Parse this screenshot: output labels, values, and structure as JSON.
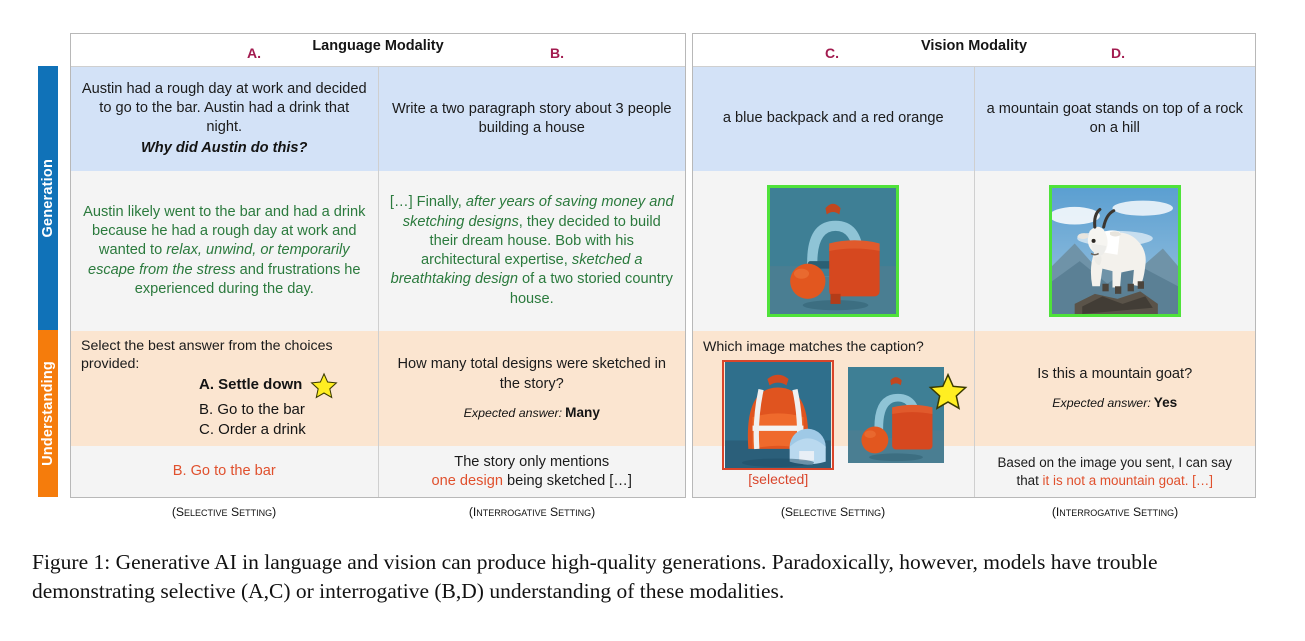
{
  "figure": {
    "sidebar": {
      "bands": [
        {
          "label": "Generation",
          "color": "#1072b8"
        },
        {
          "label": "Understanding",
          "color": "#f57c0c"
        }
      ]
    },
    "panels": [
      {
        "title": "Language Modality",
        "columns": [
          {
            "letter": "A.",
            "generation_prompt": "Austin had a rough day at work and decided to go to the bar. Austin had a drink that night.",
            "generation_prompt_question": "Why did Austin do this?",
            "generation_output_parts": [
              {
                "text": "Austin likely went to the bar and had a drink because he had a rough day at work and wanted to ",
                "italic": false
              },
              {
                "text": "relax, unwind, or temporarily escape from the stress",
                "italic": true
              },
              {
                "text": " and frustrations he experienced during the day.",
                "italic": false
              }
            ],
            "understanding_lead": "Select the best answer from the choices provided:",
            "understanding_choices": [
              "A. Settle down",
              "B. Go to the bar",
              "C. Order a drink"
            ],
            "understanding_star_on_choice": 0,
            "understanding_output": "B. Go to the bar",
            "setting": "(Selective Setting)"
          },
          {
            "letter": "B.",
            "generation_prompt": "Write a two paragraph story about 3 people building a house",
            "generation_output_parts": [
              {
                "text": "[…] Finally, ",
                "italic": false
              },
              {
                "text": "after years of saving money and sketching designs",
                "italic": true
              },
              {
                "text": ", they decided to build their dream house. Bob with his architectural expertise, ",
                "italic": false
              },
              {
                "text": "sketched a breathtaking design",
                "italic": true
              },
              {
                "text": " of a two storied country house.",
                "italic": false
              }
            ],
            "understanding_question": "How many total designs were sketched in the story?",
            "expected_label": "Expected answer:",
            "expected_value": "Many",
            "understanding_output_prefix": "The story only mentions",
            "understanding_output_highlight": "one design",
            "understanding_output_suffix": " being sketched […]",
            "setting": "(Interrogative Setting)"
          }
        ]
      },
      {
        "title": "Vision Modality",
        "columns": [
          {
            "letter": "C.",
            "generation_prompt": "a blue backpack and a red orange",
            "generation_image_alt": "generated blue backpack with red orange",
            "understanding_question": "Which image matches the caption?",
            "thumbnails": [
              {
                "alt": "orange backpack with small blue backpack",
                "selected": true
              },
              {
                "alt": "blue backpack with red bag and orange",
                "starred": true
              }
            ],
            "selected_label": "[selected]",
            "setting": "(Selective Setting)"
          },
          {
            "letter": "D.",
            "generation_prompt": "a mountain goat stands on top of a rock on a hill",
            "generation_image_alt": "generated mountain goat on rocky hill",
            "understanding_question": "Is this a mountain goat?",
            "expected_label": "Expected answer:",
            "expected_value": "Yes",
            "understanding_output_prefix": "Based on the image you sent, I can say that ",
            "understanding_output_highlight": "it is not a mountain goat. […]",
            "setting": "(Interrogative Setting)"
          }
        ]
      }
    ]
  },
  "caption": "Figure 1: Generative AI in language and vision can produce high-quality generations. Paradoxically, however, models have trouble demonstrating selective (A,C) or interrogative (B,D) understanding of these modalities.",
  "colors": {
    "generation_band": "#1072b8",
    "understanding_band": "#f57c0c",
    "prompt_blue": "#d3e2f7",
    "prompt_peach": "#fbe5d0",
    "output_grey": "#f4f4f4",
    "green_text": "#2b7a3d",
    "red_text": "#e0502d",
    "letter_maroon": "#a21b4f",
    "image_border_green": "#4fe23a",
    "thumb_border_red": "#d9452b",
    "star_yellow": "#ffee22"
  }
}
